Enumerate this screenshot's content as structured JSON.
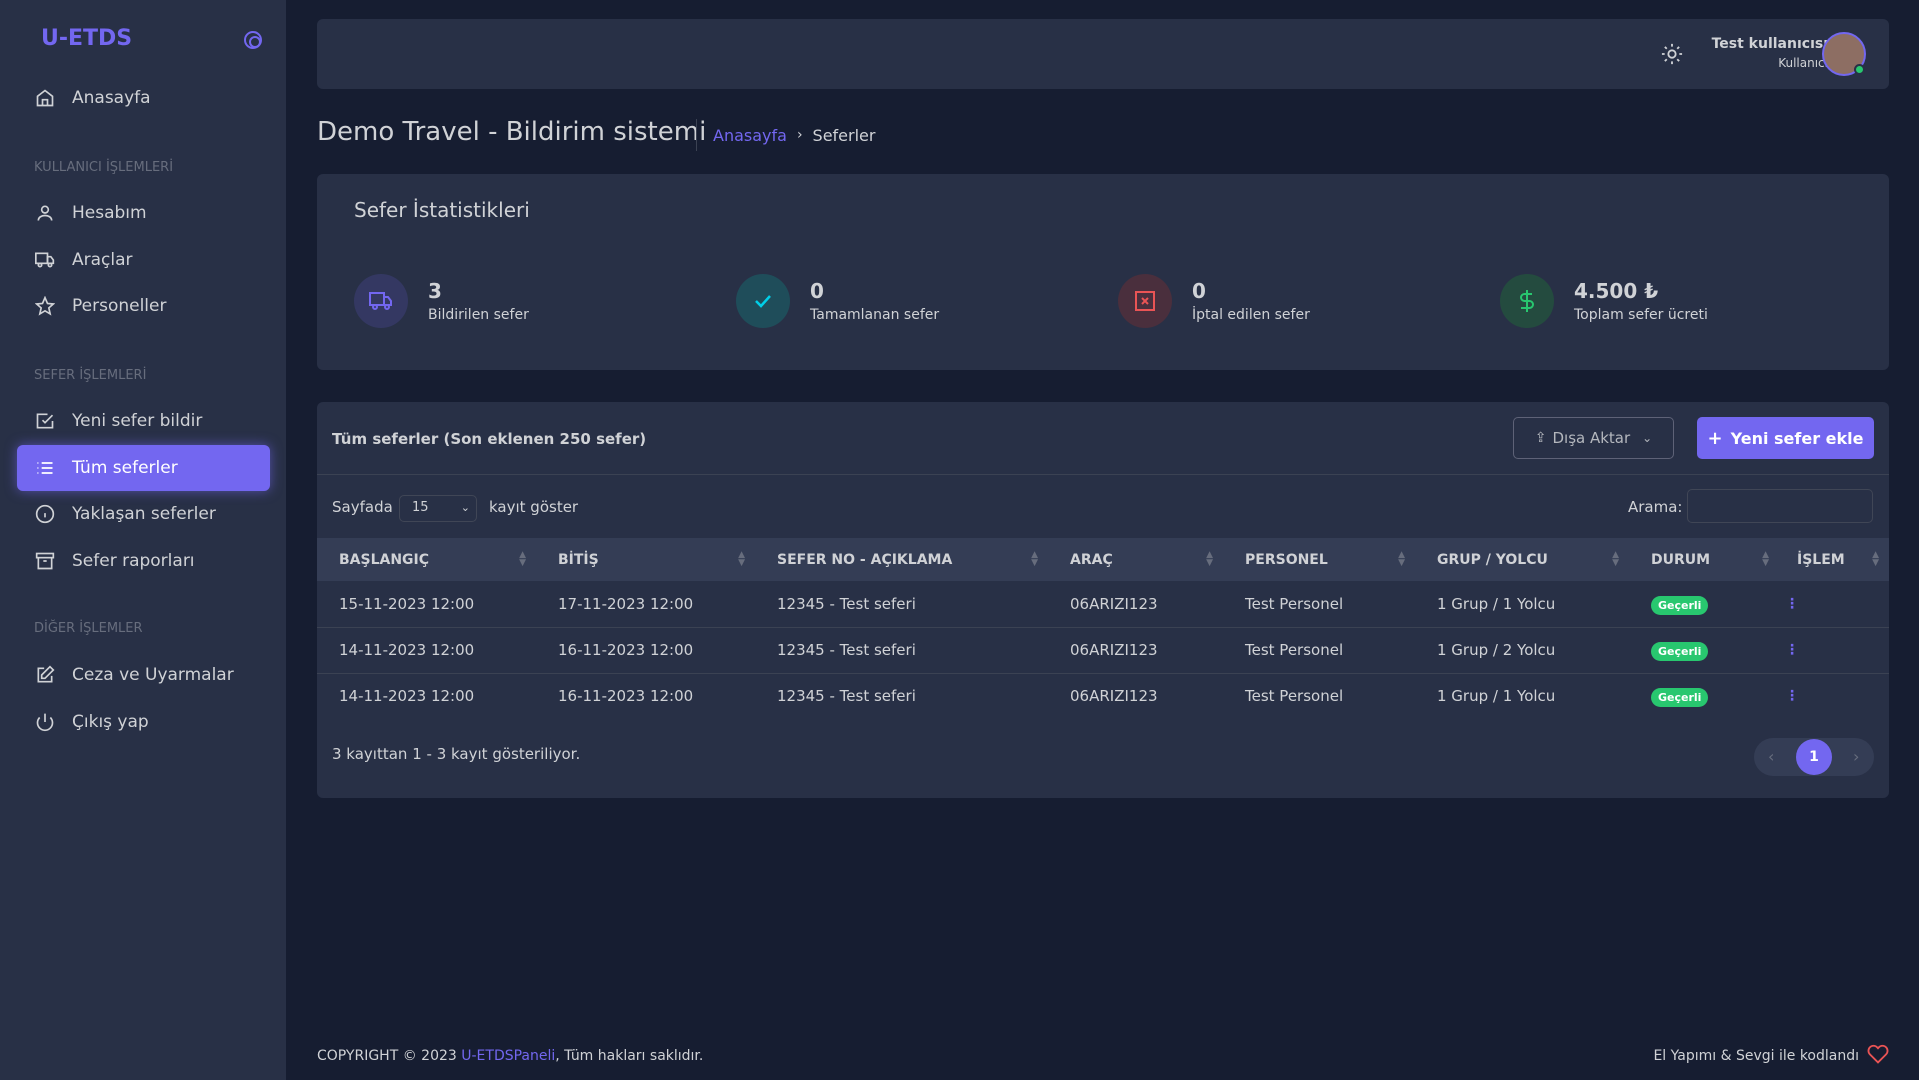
{
  "app": {
    "brand": "U-ETDS"
  },
  "sidebar": {
    "items": [
      {
        "label": "Anasayfa"
      }
    ],
    "section1": "KULLANICI İŞLEMLERİ",
    "user_items": [
      {
        "label": "Hesabım"
      },
      {
        "label": "Araçlar"
      },
      {
        "label": "Personeller"
      }
    ],
    "section2": "SEFER İŞLEMLERİ",
    "trip_items": [
      {
        "label": "Yeni sefer bildir"
      },
      {
        "label": "Tüm seferler"
      },
      {
        "label": "Yaklaşan seferler"
      },
      {
        "label": "Sefer raporları"
      }
    ],
    "section3": "DİĞER İŞLEMLER",
    "other_items": [
      {
        "label": "Ceza ve Uyarmalar"
      },
      {
        "label": "Çıkış yap"
      }
    ]
  },
  "header": {
    "user_name": "Test kullanıcısı",
    "user_role": "Kullanıcı"
  },
  "page": {
    "title": "Demo Travel - Bildirim sistemi",
    "breadcrumb_home": "Anasayfa",
    "breadcrumb_current": "Seferler"
  },
  "stats": {
    "title": "Sefer İstatistikleri",
    "items": [
      {
        "value": "3",
        "label": "Bildirilen sefer"
      },
      {
        "value": "0",
        "label": "Tamamlanan sefer"
      },
      {
        "value": "0",
        "label": "İptal edilen sefer"
      },
      {
        "value": "4.500 ₺",
        "label": "Toplam sefer ücreti"
      }
    ]
  },
  "trips": {
    "title": "Tüm seferler (Son eklenen 250 sefer)",
    "export_label": "Dışa Aktar",
    "add_label": "Yeni sefer ekle",
    "page_label": "Sayfada",
    "page_size": "15",
    "show_label": "kayıt göster",
    "search_label": "Arama:",
    "columns": [
      "BAŞLANGIÇ",
      "BİTİŞ",
      "SEFER NO - AÇIKLAMA",
      "ARAÇ",
      "PERSONEL",
      "GRUP / YOLCU",
      "DURUM",
      "İŞLEM"
    ],
    "rows": [
      [
        "15-11-2023 12:00",
        "17-11-2023 12:00",
        "12345 - Test seferi",
        "06ARIZI123",
        "Test Personel",
        "1 Grup / 1 Yolcu",
        "Geçerli"
      ],
      [
        "14-11-2023 12:00",
        "16-11-2023 12:00",
        "12345 - Test seferi",
        "06ARIZI123",
        "Test Personel",
        "1 Grup / 2 Yolcu",
        "Geçerli"
      ],
      [
        "14-11-2023 12:00",
        "16-11-2023 12:00",
        "12345 - Test seferi",
        "06ARIZI123",
        "Test Personel",
        "1 Grup / 1 Yolcu",
        "Geçerli"
      ]
    ],
    "info": "3 kayıttan 1 - 3 kayıt gösteriliyor.",
    "current_page": "1"
  },
  "footer": {
    "copyright_prefix": "COPYRIGHT © 2023 ",
    "copyright_link": "U-ETDSPaneli",
    "copyright_suffix": ", Tüm hakları saklıdır.",
    "made_with": "El Yapımı & Sevgi ile kodlandı"
  },
  "colors": {
    "primary": "#7367f0",
    "success": "#28c76f",
    "danger": "#ea5455",
    "info": "#00cfe8",
    "background": "#161d31",
    "card": "#283046"
  }
}
